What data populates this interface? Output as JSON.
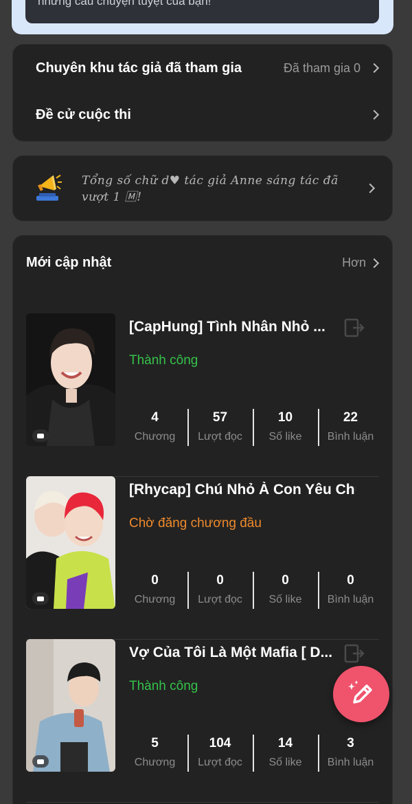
{
  "banner": {
    "text": "những câu chuyện tuyệt của bạn!"
  },
  "menu": {
    "zone": {
      "label": "Chuyên khu tác giả đã tham gia",
      "value": "Đã tham gia 0"
    },
    "contest": {
      "label": "Đề cử cuộc thi"
    }
  },
  "notice": {
    "text": "Tổng số chữ d♥ tác giả Anne sáng tác đã vượt 1 🄼!"
  },
  "updates": {
    "title": "Mới cập nhật",
    "more_label": "Hơn",
    "stat_labels": {
      "chapters": "Chương",
      "reads": "Lượt đọc",
      "likes": "Số like",
      "comments": "Bình luận"
    },
    "stories": [
      {
        "title": "[CapHung] Tình Nhân Nhỏ ...",
        "status": "Thành công",
        "chapters": "4",
        "reads": "57",
        "likes": "10",
        "comments": "22"
      },
      {
        "title": "[Rhycap] Chú Nhỏ À Con Yêu Chú",
        "status": "Chờ đăng chương đầu",
        "chapters": "0",
        "reads": "0",
        "likes": "0",
        "comments": "0"
      },
      {
        "title": "Vợ Của Tôi Là Một Mafia [ D...",
        "status": "Thành công",
        "chapters": "5",
        "reads": "104",
        "likes": "14",
        "comments": "3"
      }
    ]
  },
  "colors": {
    "success": "#35c24a",
    "pending": "#ef8a2c",
    "fab": "#f0536c",
    "card": "#222222",
    "background": "#3a3a3a"
  },
  "icons": {
    "fab": "pencil-sparkle-icon",
    "notice": "megaphone-icon",
    "story_action": "exit-icon",
    "cover_badge": "comment-icon"
  }
}
